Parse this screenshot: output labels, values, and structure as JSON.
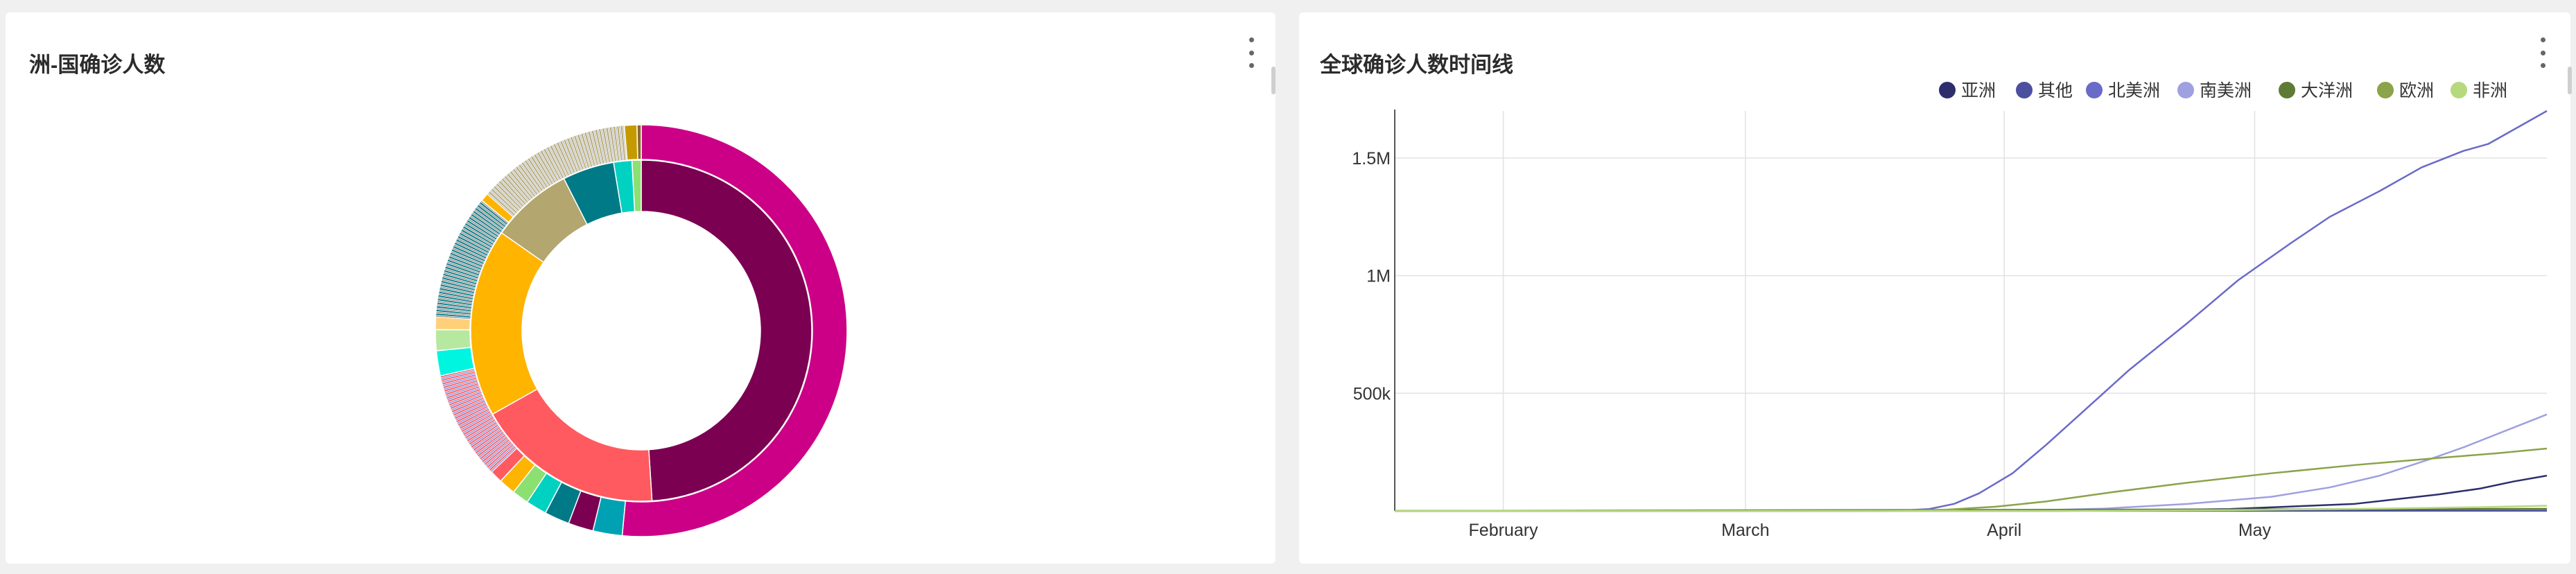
{
  "left_panel": {
    "title": "洲-国确诊人数"
  },
  "right_panel": {
    "title": "全球确诊人数时间线"
  },
  "chart_data": [
    {
      "type": "sunburst",
      "title": "洲-国确诊人数",
      "inner_ring": [
        {
          "value": 1.7,
          "color": "#7b0051"
        },
        {
          "value": 0.62,
          "color": "#ff5a5f"
        },
        {
          "value": 0.62,
          "color": "#ffb400"
        },
        {
          "value": 0.27,
          "color": "#b3a66e"
        },
        {
          "value": 0.17,
          "color": "#007a87"
        },
        {
          "value": 0.06,
          "color": "#00d1c1"
        },
        {
          "value": 0.03,
          "color": "#8ce071"
        }
      ],
      "outer_ring": [
        {
          "value": 1.57,
          "color": "#cc0086"
        },
        {
          "value": 0.07,
          "color": "#00a1b3"
        },
        {
          "value": 0.06,
          "color": "#7b0051"
        },
        {
          "value": 0.06,
          "color": "#007a87"
        },
        {
          "value": 0.05,
          "color": "#00d1c1"
        },
        {
          "value": 0.04,
          "color": "#8ce071"
        },
        {
          "value": 0.04,
          "color": "#ffb400"
        },
        {
          "value": 0.03,
          "color": "#ff5a5f"
        },
        {
          "value": 0.26,
          "color": "#mixed"
        },
        {
          "value": 0.06,
          "color": "#00f5e0"
        },
        {
          "value": 0.05,
          "color": "#b7e8a0"
        },
        {
          "value": 0.03,
          "color": "#ffd07a"
        },
        {
          "value": 0.3,
          "color": "#mixed"
        },
        {
          "value": 0.02,
          "color": "#ffb400"
        },
        {
          "value": 0.37,
          "color": "#mixed"
        },
        {
          "value": 0.03,
          "color": "#c49a00"
        },
        {
          "value": 0.01,
          "color": "#8b6b2e"
        }
      ]
    },
    {
      "type": "line",
      "title": "全球确诊人数时间线",
      "x_ticks": [
        "February",
        "March",
        "April",
        "May"
      ],
      "y_ticks": [
        "500k",
        "1M",
        "1.5M"
      ],
      "ylim": [
        0,
        1700000
      ],
      "xlim_days": [
        0,
        138
      ],
      "series": [
        {
          "name": "亚洲",
          "color": "#2d2e6b",
          "points": [
            [
              0,
              0
            ],
            [
              80,
              500
            ],
            [
              100,
              8000
            ],
            [
              115,
              30000
            ],
            [
              125,
              70000
            ],
            [
              130,
              95000
            ],
            [
              134,
              125000
            ],
            [
              138,
              150000
            ]
          ]
        },
        {
          "name": "其他",
          "color": "#4b4f9e",
          "points": [
            [
              0,
              0
            ],
            [
              138,
              700
            ]
          ]
        },
        {
          "name": "北美洲",
          "color": "#6a6ac9",
          "points": [
            [
              0,
              0
            ],
            [
              55,
              0
            ],
            [
              60,
              500
            ],
            [
              64,
              8000
            ],
            [
              67,
              30000
            ],
            [
              70,
              75000
            ],
            [
              74,
              160000
            ],
            [
              78,
              280000
            ],
            [
              83,
              440000
            ],
            [
              88,
              600000
            ],
            [
              95,
              800000
            ],
            [
              101,
              980000
            ],
            [
              107,
              1130000
            ],
            [
              112,
              1250000
            ],
            [
              118,
              1360000
            ],
            [
              123,
              1460000
            ],
            [
              128,
              1530000
            ],
            [
              131,
              1560000
            ],
            [
              135,
              1640000
            ],
            [
              138,
              1700000
            ]
          ]
        },
        {
          "name": "南美洲",
          "color": "#9ea0e0",
          "points": [
            [
              0,
              0
            ],
            [
              75,
              1000
            ],
            [
              85,
              10000
            ],
            [
              95,
              30000
            ],
            [
              105,
              60000
            ],
            [
              112,
              100000
            ],
            [
              118,
              150000
            ],
            [
              124,
              220000
            ],
            [
              128,
              270000
            ],
            [
              133,
              340000
            ],
            [
              138,
              410000
            ]
          ]
        },
        {
          "name": "大洋洲",
          "color": "#5f7a35",
          "points": [
            [
              0,
              0
            ],
            [
              138,
              9000
            ]
          ]
        },
        {
          "name": "欧洲",
          "color": "#8ba34a",
          "points": [
            [
              0,
              0
            ],
            [
              60,
              1000
            ],
            [
              66,
              5000
            ],
            [
              72,
              18000
            ],
            [
              78,
              40000
            ],
            [
              86,
              80000
            ],
            [
              95,
              120000
            ],
            [
              105,
              160000
            ],
            [
              115,
              195000
            ],
            [
              125,
              225000
            ],
            [
              132,
              245000
            ],
            [
              138,
              265000
            ]
          ]
        },
        {
          "name": "非洲",
          "color": "#b6d97e",
          "points": [
            [
              0,
              0
            ],
            [
              80,
              200
            ],
            [
              100,
              3000
            ],
            [
              118,
              10000
            ],
            [
              130,
              16000
            ],
            [
              138,
              22000
            ]
          ]
        }
      ]
    }
  ]
}
